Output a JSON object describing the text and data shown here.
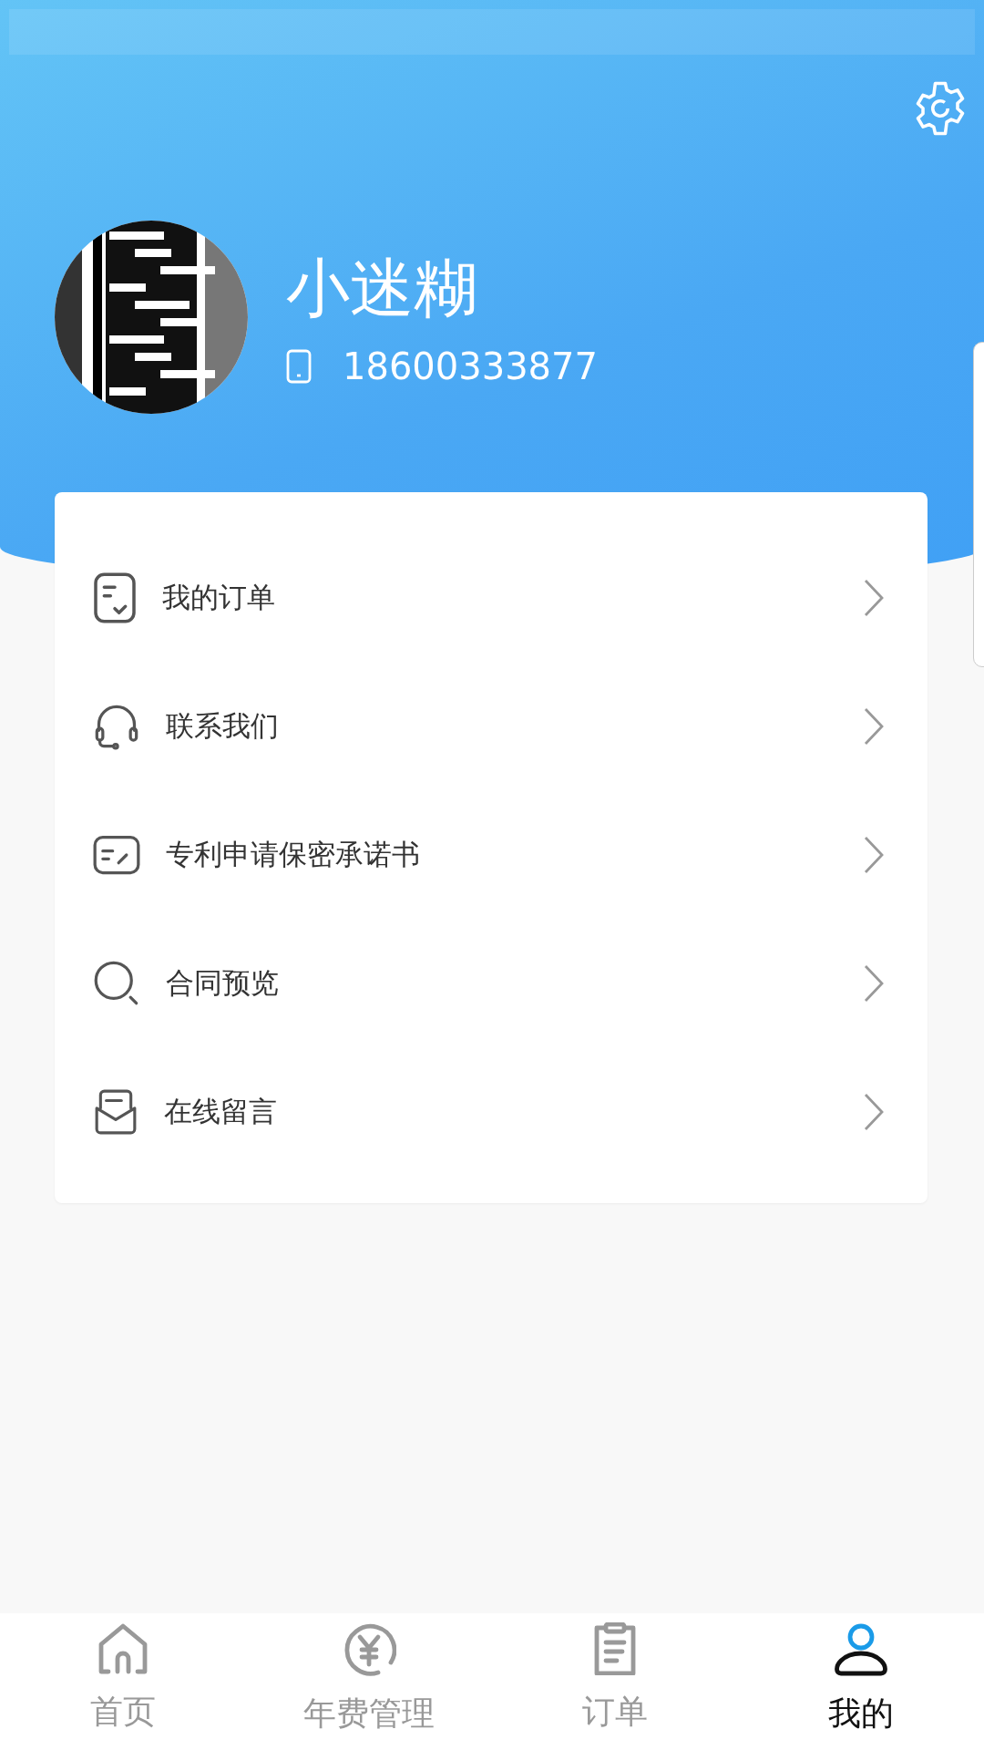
{
  "profile": {
    "name": "小迷糊",
    "phone": "18600333877"
  },
  "menu": [
    {
      "kind": "order",
      "label": "我的订单"
    },
    {
      "kind": "contact",
      "label": "联系我们"
    },
    {
      "kind": "pledge",
      "label": "专利申请保密承诺书"
    },
    {
      "kind": "preview",
      "label": "合同预览"
    },
    {
      "kind": "message",
      "label": "在线留言"
    }
  ],
  "tab_bar": [
    {
      "kind": "home",
      "label": "首页",
      "selected": false
    },
    {
      "kind": "fee",
      "label": "年费管理",
      "selected": false
    },
    {
      "kind": "orders",
      "label": "订单",
      "selected": false
    },
    {
      "kind": "me",
      "label": "我的",
      "selected": true
    }
  ]
}
